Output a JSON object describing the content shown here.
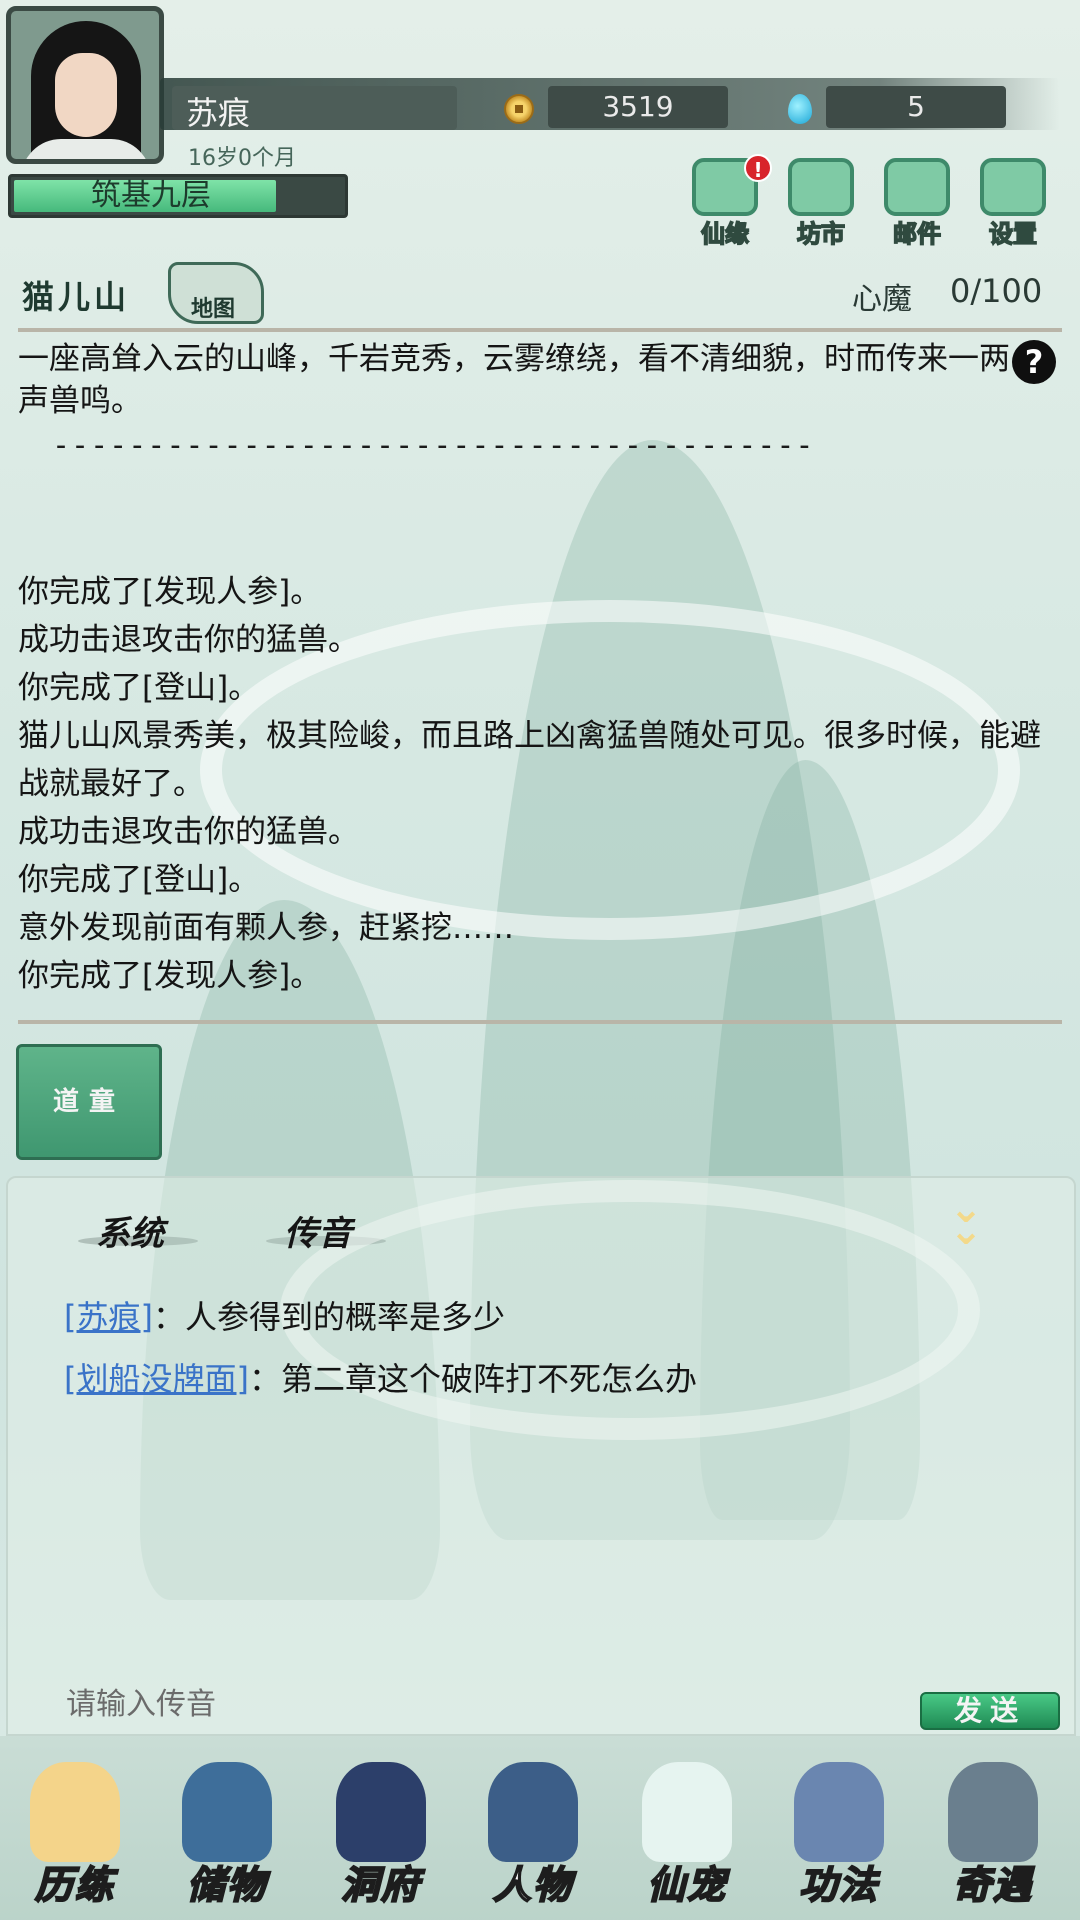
{
  "player": {
    "name": "苏痕",
    "age": "16岁0个月",
    "realm": "筑基九层",
    "realm_progress": 0.8,
    "coins": "3519",
    "gems": "5"
  },
  "top_menu": [
    {
      "label": "仙缘",
      "icon": "cloud-icon",
      "badge": "!"
    },
    {
      "label": "坊市",
      "icon": "market-icon"
    },
    {
      "label": "邮件",
      "icon": "mail-icon"
    },
    {
      "label": "设置",
      "icon": "gear-icon"
    }
  ],
  "location": {
    "name": "猫儿山",
    "map_label": "地图",
    "demon_label": "心魔",
    "demon_value": "0/100"
  },
  "description": "一座高耸入云的山峰，千岩竞秀，云雾缭绕，看不清细貌，时而传来一两声兽鸣。",
  "separator": "----------------------------------------",
  "log": [
    "",
    "你完成了[发现人参]。",
    "成功击退攻击你的猛兽。",
    "你完成了[登山]。",
    "猫儿山风景秀美，极其险峻，而且路上凶禽猛兽随处可见。很多时候，能避战就最好了。",
    "成功击退攻击你的猛兽。",
    "你完成了[登山]。",
    "意外发现前面有颗人参，赶紧挖……",
    "你完成了[发现人参]。"
  ],
  "companion_button": "道童",
  "chat": {
    "tabs": [
      "系统",
      "传音"
    ],
    "messages": [
      {
        "sender": "[苏痕]",
        "text": "：人参得到的概率是多少"
      },
      {
        "sender": "[划船没牌面]",
        "text": "：第二章这个破阵打不死怎么办"
      }
    ],
    "input_placeholder": "请输入传音",
    "send_label": "发送"
  },
  "bottom_nav": [
    {
      "label": "历练",
      "icon": "mountain-icon",
      "color": "#f4d48a"
    },
    {
      "label": "储物",
      "icon": "bag-icon",
      "color": "#3e6e9a"
    },
    {
      "label": "洞府",
      "icon": "pavilion-icon",
      "color": "#2c3f6a"
    },
    {
      "label": "人物",
      "icon": "person-icon",
      "color": "#3c5e88"
    },
    {
      "label": "仙宠",
      "icon": "ghost-pet-icon",
      "color": "#e6f4f0"
    },
    {
      "label": "功法",
      "icon": "scroll-book-icon",
      "color": "#6a86b0"
    },
    {
      "label": "奇遇",
      "icon": "brush-icon",
      "color": "#6a7f8e"
    }
  ]
}
